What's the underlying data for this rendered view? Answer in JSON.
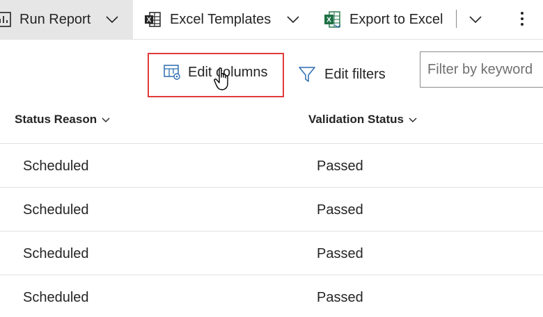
{
  "toolbar": {
    "run_report_label": "Run Report",
    "excel_templates_label": "Excel Templates",
    "export_excel_label": "Export to Excel"
  },
  "commands": {
    "edit_columns_label": "Edit columns",
    "edit_filters_label": "Edit filters",
    "filter_placeholder": "Filter by keyword"
  },
  "grid": {
    "columns": [
      "Status Reason",
      "Validation Status"
    ],
    "rows": [
      [
        "Scheduled",
        "Passed"
      ],
      [
        "Scheduled",
        "Passed"
      ],
      [
        "Scheduled",
        "Passed"
      ],
      [
        "Scheduled",
        "Passed"
      ]
    ]
  },
  "colors": {
    "highlight_border": "#e03a3a",
    "excel_green": "#1e7145",
    "icon_blue": "#2b6cb0",
    "toolbar_selected_bg": "#e6e6e6"
  }
}
